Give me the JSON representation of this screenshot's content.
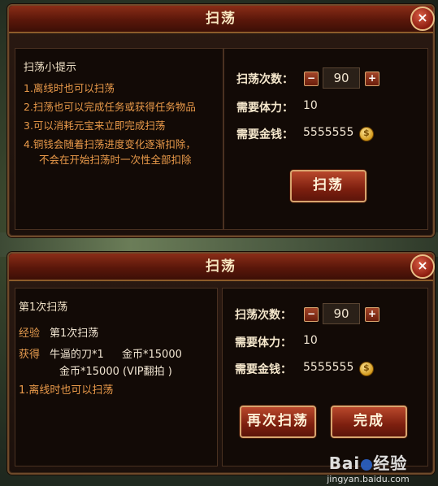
{
  "dialog1": {
    "title": "扫荡",
    "close_label": "×",
    "tips_title": "扫荡小提示",
    "tips": [
      "1.离线时也可以扫荡",
      "2.扫荡也可以完成任务或获得任务物品",
      "3.可以消耗元宝来立即完成扫荡",
      "4.铜钱会随着扫荡进度变化逐渐扣除，",
      "不会在开始扫荡时一次性全部扣除"
    ],
    "count_label": "扫荡次数：",
    "minus_label": "−",
    "count_value": "90",
    "plus_label": "+",
    "stamina_label": "需要体力：",
    "stamina_value": "10",
    "gold_label": "需要金钱：",
    "gold_value": "5555555",
    "sweep_button": "扫荡"
  },
  "dialog2": {
    "title": "扫荡",
    "close_label": "×",
    "round_title": "第1次扫荡",
    "exp_label": "经验",
    "exp_value": "第1次扫荡",
    "obtain_label": "获得",
    "obtain_line1_item": "牛逼的刀*1",
    "obtain_line1_gold": "金币*15000",
    "obtain_line2": "金币*15000 (VIP翻拍 )",
    "tip": "1.离线时也可以扫荡",
    "count_label": "扫荡次数：",
    "minus_label": "−",
    "count_value": "90",
    "plus_label": "+",
    "stamina_label": "需要体力：",
    "stamina_value": "10",
    "gold_label": "需要金钱：",
    "gold_value": "5555555",
    "again_button": "再次扫荡",
    "done_button": "完成"
  },
  "watermark": {
    "brand": "Bai",
    "brand2": "经验",
    "url": "jingyan.baidu.com"
  }
}
